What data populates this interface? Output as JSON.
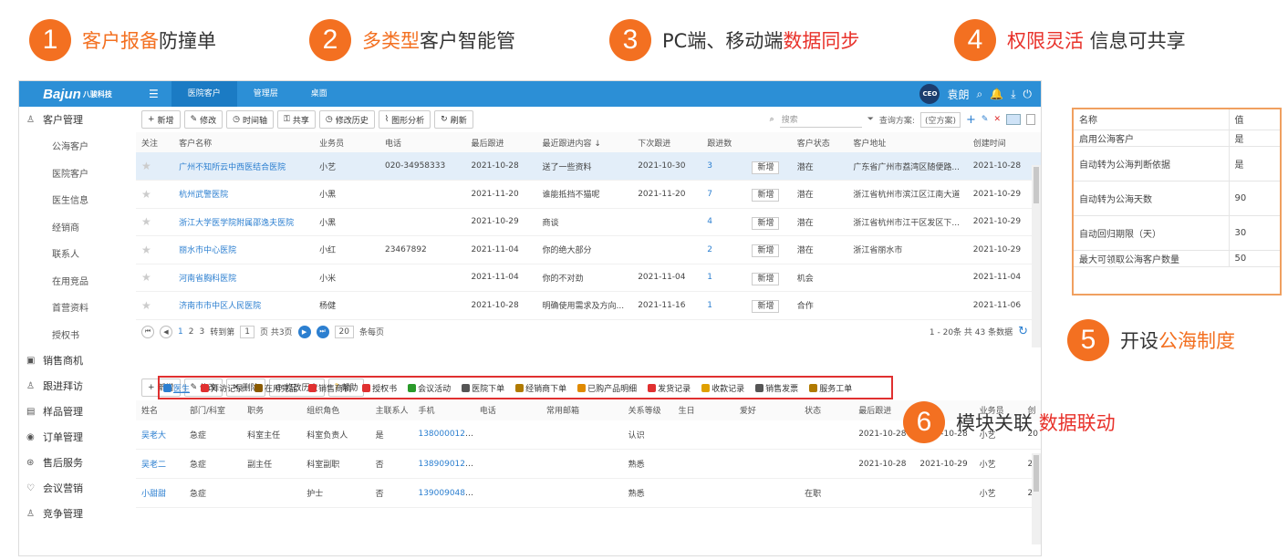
{
  "features": [
    {
      "num": "1",
      "a": "客户报备",
      "b": "防撞单"
    },
    {
      "num": "2",
      "a": "多类型",
      "b": "客户智能管"
    },
    {
      "num": "3",
      "b": "PC端、移动端",
      "a": "数据同步"
    },
    {
      "num": "4",
      "a": "权限灵活",
      "b": " 信息可共享"
    }
  ],
  "f5": {
    "num": "5",
    "b": "开设",
    "a": "公海制度"
  },
  "f6": {
    "num": "6",
    "b": "模块关联 ",
    "a": "数据联动"
  },
  "app": {
    "logo": "Bajun",
    "logo_cn": "八骏科技",
    "tabs": [
      "医院客户",
      "管理层",
      "桌面"
    ],
    "user": "袁朗",
    "ceo": "CEO"
  },
  "sidebar": {
    "g1": "客户管理",
    "items": [
      "公海客户",
      "医院客户",
      "医生信息",
      "经销商",
      "联系人",
      "在用竞品",
      "首营资料",
      "授权书"
    ],
    "groups": [
      "销售商机",
      "跟进拜访",
      "样品管理",
      "订单管理",
      "售后服务",
      "会议营销",
      "竞争管理"
    ]
  },
  "toolbar": {
    "buttons": [
      "新增",
      "修改",
      "时间轴",
      "共享",
      "修改历史",
      "图形分析",
      "刷新"
    ],
    "search": "搜索",
    "scheme_label": "查询方案:",
    "scheme": "(空方案)"
  },
  "table": {
    "headers": [
      "关注",
      "客户名称",
      "业务员",
      "电话",
      "最后跟进",
      "最近跟进内容 ↓",
      "下次跟进",
      "跟进数",
      "",
      "客户状态",
      "客户地址",
      "创建时间"
    ],
    "rows": [
      [
        "★",
        "广州不知所云中西医结合医院",
        "小艺",
        "020-34958333",
        "2021-10-28",
        "送了一些资料",
        "2021-10-30",
        "3",
        "新增",
        "潜在",
        "广东省广州市荔湾区随便路...",
        "2021-10-28"
      ],
      [
        "★",
        "杭州武警医院",
        "小黑",
        "",
        "2021-11-20",
        "谁能抵挡不猫呢",
        "2021-11-20",
        "7",
        "新增",
        "潜在",
        "浙江省杭州市滨江区江南大道",
        "2021-10-29"
      ],
      [
        "★",
        "浙江大学医学院附属邵逸夫医院",
        "小黑",
        "",
        "2021-10-29",
        "商谈",
        "",
        "4",
        "新增",
        "潜在",
        "浙江省杭州市江干区发区下...",
        "2021-10-29"
      ],
      [
        "★",
        "丽水市中心医院",
        "小红",
        "23467892",
        "2021-11-04",
        "你的绝大部分",
        "",
        "2",
        "新增",
        "潜在",
        "浙江省丽水市",
        "2021-10-29"
      ],
      [
        "★",
        "河南省胸科医院",
        "小米",
        "",
        "2021-11-04",
        "你的不对劲",
        "2021-11-04",
        "1",
        "新增",
        "机会",
        "",
        "2021-11-04"
      ],
      [
        "★",
        "济南市市中区人民医院",
        "杨健",
        "",
        "2021-10-28",
        "明确使用需求及方向...",
        "2021-11-16",
        "1",
        "新增",
        "合作",
        "",
        "2021-11-06"
      ]
    ]
  },
  "pager": {
    "pages": [
      "1",
      "2",
      "3"
    ],
    "goto": "转到第",
    "page_val": "1",
    "total_pages": "页 共3页",
    "size": "20",
    "per": "条每页",
    "summary": "1 - 20条  共 43 条数据"
  },
  "modules": [
    "医生",
    "拜访记录",
    "在用竞品",
    "销售商机",
    "授权书",
    "会议活动",
    "医院下单",
    "经销商下单",
    "已购产品明细",
    "发货记录",
    "收款记录",
    "销售发票",
    "服务工单"
  ],
  "subtoolbar": [
    "新增",
    "修改",
    "删除",
    "修改历史",
    "帮助"
  ],
  "subtable": {
    "headers": [
      "姓名",
      "部门/科室",
      "职务",
      "组织角色",
      "主联系人",
      "手机",
      "电话",
      "常用邮箱",
      "关系等级",
      "生日",
      "爱好",
      "状态",
      "最后跟进",
      "",
      "业务员",
      "创"
    ],
    "rows": [
      [
        "吴老大",
        "急症",
        "科室主任",
        "科室负责人",
        "是",
        "13800001245",
        "",
        "",
        "认识",
        "",
        "",
        "",
        "2021-10-28",
        "2021-10-28",
        "小艺",
        "20"
      ],
      [
        "吴老二",
        "急症",
        "副主任",
        "科室副职",
        "否",
        "13890901234",
        "",
        "",
        "熟悉",
        "",
        "",
        "",
        "2021-10-28",
        "2021-10-29",
        "小艺",
        "20"
      ],
      [
        "小甜甜",
        "急症",
        "",
        "护士",
        "否",
        "13900904857",
        "",
        "",
        "熟悉",
        "",
        "",
        "在职",
        "",
        "",
        "小艺",
        "20"
      ]
    ]
  },
  "settings": {
    "headers": [
      "名称",
      "值"
    ],
    "rows": [
      [
        "启用公海客户",
        "是"
      ],
      [
        "自动转为公海判断依据",
        "是"
      ],
      [
        "自动转为公海天数",
        "90"
      ],
      [
        "自动回归期限（天）",
        "30"
      ],
      [
        "最大可领取公海客户数量",
        "50"
      ]
    ]
  }
}
